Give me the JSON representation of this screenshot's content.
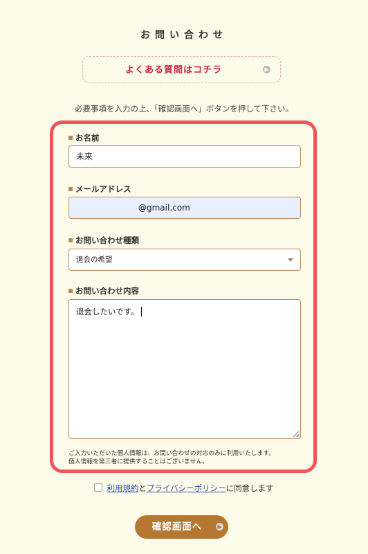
{
  "page": {
    "title": "お問い合わせ"
  },
  "faq": {
    "label": "よくある質問はコチラ",
    "arrow_icon": "arrow-right-circle-icon"
  },
  "instruction": "必要事項を入力の上、「確認画面へ」ボタンを押して下さい。",
  "form": {
    "name": {
      "label": "お名前",
      "value": "未来"
    },
    "email": {
      "label": "メールアドレス",
      "value": "@gmail.com"
    },
    "inquiry_type": {
      "label": "お問い合わせ種類",
      "selected": "退会の希望"
    },
    "message": {
      "label": "お問い合わせ内容",
      "value": "退会したいです。"
    },
    "privacy_note_line1": "ご入力いただいた個人情報は、お問い合わせの対応のみに利用いたします。",
    "privacy_note_line2": "個人情報を第三者に提供することはございません。"
  },
  "agreement": {
    "terms_link": "利用規約",
    "connector": "と",
    "privacy_link": "プライバシーポリシー",
    "suffix": "に同意します",
    "checked": false
  },
  "confirm_button": {
    "label": "確認画面へ"
  },
  "colors": {
    "background": "#fdfbea",
    "panel_border": "#f25558",
    "faq_text": "#c6243f",
    "button": "#b67831",
    "link": "#2b4fa7"
  }
}
